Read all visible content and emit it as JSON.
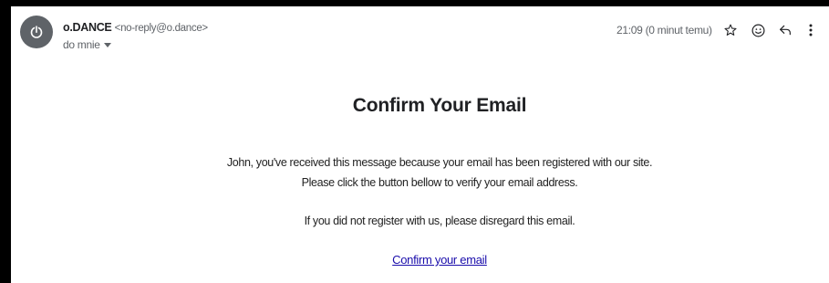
{
  "header": {
    "sender_name": "o.DANCE",
    "sender_email": "<no-reply@o.dance>",
    "recipient": "do mnie",
    "timestamp": "21:09 (0 minut temu)",
    "avatar_icon": "power-icon",
    "actions": [
      "star-icon",
      "emoji-icon",
      "reply-icon",
      "more-vert-icon"
    ]
  },
  "email": {
    "title": "Confirm Your Email",
    "line1": "John, you've received this message because your email has been registered with our site.",
    "line2": "Please click the button bellow to verify your email address.",
    "line3": "If you did not register with us, please disregard this email.",
    "confirm_link": "Confirm your email"
  },
  "colors": {
    "frame_background": "#000000",
    "panel_background": "#ffffff",
    "avatar_background": "#5f6368",
    "link": "#1a0dab",
    "text": "#202124"
  }
}
